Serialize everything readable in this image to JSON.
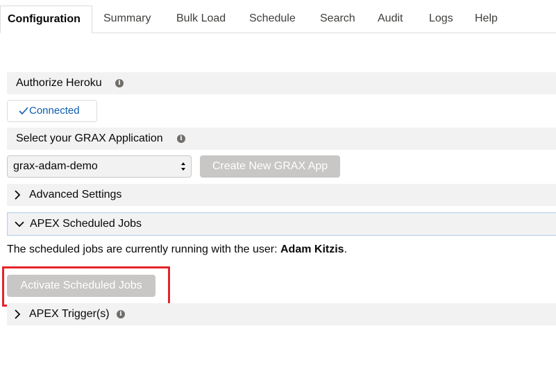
{
  "tabs": [
    {
      "label": "Configuration",
      "active": true
    },
    {
      "label": "Summary"
    },
    {
      "label": "Bulk Load"
    },
    {
      "label": "Schedule"
    },
    {
      "label": "Search"
    },
    {
      "label": "Audit"
    },
    {
      "label": "Logs"
    },
    {
      "label": "Help"
    }
  ],
  "heroku": {
    "title": "Authorize Heroku",
    "info_icon": "info-icon",
    "connected_label": "Connected",
    "connected_icon": "check-icon"
  },
  "grax_app": {
    "title": "Select your GRAX Application",
    "info_icon": "info-icon",
    "selected_app": "grax-adam-demo",
    "create_button": "Create New GRAX App"
  },
  "advanced": {
    "title": "Advanced Settings",
    "expanded": false
  },
  "apex_jobs": {
    "title": "APEX Scheduled Jobs",
    "expanded": true,
    "message_prefix": "The scheduled jobs are currently running with the user: ",
    "user": "Adam Kitzis",
    "message_suffix": ".",
    "activate_button": "Activate Scheduled Jobs"
  },
  "apex_triggers": {
    "title": "APEX Trigger(s)",
    "expanded": false,
    "info_icon": "info-icon"
  },
  "colors": {
    "highlight": "#e3242b",
    "section_bg": "#f3f2f2",
    "link": "#0a5cb0",
    "disabled_button": "#c9c7c5"
  }
}
